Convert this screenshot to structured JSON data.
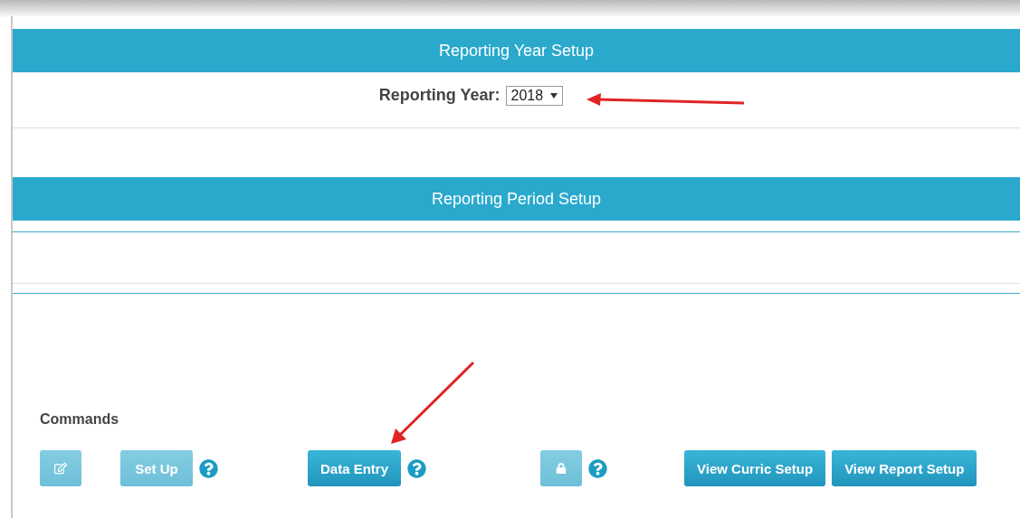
{
  "year_section": {
    "title": "Reporting Year Setup",
    "label": "Reporting Year:",
    "year_select": {
      "value": "2018"
    }
  },
  "period_section": {
    "title": "Reporting Period Setup"
  },
  "commands": {
    "title": "Commands",
    "buttons": [
      {
        "kind": "edit",
        "disabled": true
      },
      {
        "kind": "text",
        "label": "Set Up",
        "disabled": true,
        "help": true
      },
      {
        "kind": "text",
        "label": "Data Entry",
        "disabled": false,
        "help": true
      },
      {
        "kind": "lock",
        "disabled": true,
        "help": true
      },
      {
        "kind": "text",
        "label": "View Curric Setup",
        "disabled": false
      },
      {
        "kind": "text",
        "label": "View Report Setup",
        "disabled": false
      }
    ]
  }
}
